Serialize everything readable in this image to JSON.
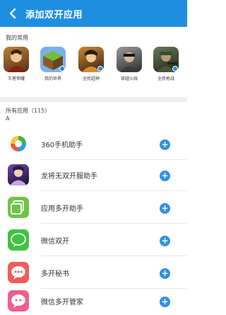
{
  "header": {
    "title": "添加双开应用"
  },
  "recent": {
    "label": "我的常用",
    "apps": [
      {
        "name": "王者荣耀"
      },
      {
        "name": "我的世界"
      },
      {
        "name": "全民超神"
      },
      {
        "name": "穿越火线"
      },
      {
        "name": "全民枪战"
      }
    ]
  },
  "all_apps": {
    "label": "所有应用（115）",
    "index_letter": "A",
    "items": [
      {
        "name": "360手机助手"
      },
      {
        "name": "龙将无双开服助手"
      },
      {
        "name": "应用多开助手"
      },
      {
        "name": "微信双开"
      },
      {
        "name": "多开秘书"
      },
      {
        "name": "微信多开管家"
      }
    ],
    "add_symbol": "+"
  },
  "colors": {
    "accent": "#1e8fe0",
    "wechat_green": "#3fc441",
    "multi_green": "#6cc644",
    "red": "#f25b56"
  }
}
